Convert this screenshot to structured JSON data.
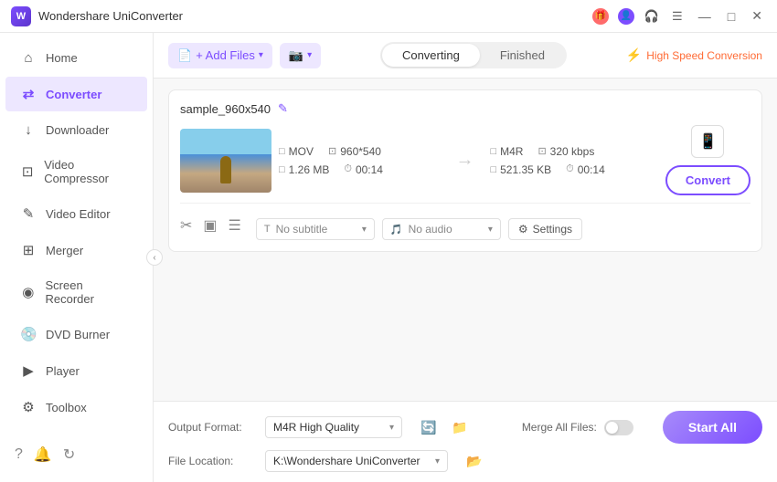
{
  "app": {
    "title": "Wondershare UniConverter",
    "logo_text": "W"
  },
  "titlebar": {
    "title": "Wondershare UniConverter",
    "icons": {
      "gift": "🎁",
      "user": "👤",
      "headset": "🎧",
      "menu": "☰",
      "minimize": "—",
      "maximize": "□",
      "close": "✕"
    }
  },
  "sidebar": {
    "items": [
      {
        "id": "home",
        "label": "Home",
        "icon": "⌂"
      },
      {
        "id": "converter",
        "label": "Converter",
        "icon": "⇄",
        "active": true
      },
      {
        "id": "downloader",
        "label": "Downloader",
        "icon": "↓"
      },
      {
        "id": "video-compressor",
        "label": "Video Compressor",
        "icon": "⊡"
      },
      {
        "id": "video-editor",
        "label": "Video Editor",
        "icon": "✎"
      },
      {
        "id": "merger",
        "label": "Merger",
        "icon": "⊞"
      },
      {
        "id": "screen-recorder",
        "label": "Screen Recorder",
        "icon": "◉"
      },
      {
        "id": "dvd-burner",
        "label": "DVD Burner",
        "icon": "💿"
      },
      {
        "id": "player",
        "label": "Player",
        "icon": "▶"
      },
      {
        "id": "toolbox",
        "label": "Toolbox",
        "icon": "⚙"
      }
    ],
    "bottom_icons": [
      "?",
      "🔔",
      "↻"
    ]
  },
  "toolbar": {
    "add_button": "+ Add Files",
    "snapshot_button": "📷",
    "tabs": {
      "converting": "Converting",
      "finished": "Finished"
    },
    "active_tab": "Converting",
    "high_speed": "High Speed Conversion",
    "bolt": "⚡"
  },
  "file": {
    "name": "sample_960x540",
    "edit_icon": "✎",
    "input": {
      "format": "MOV",
      "resolution": "960*540",
      "size": "1.26 MB",
      "duration": "00:14"
    },
    "arrow": "→",
    "output": {
      "format": "M4R",
      "bitrate": "320 kbps",
      "size": "521.35 KB",
      "duration": "00:14"
    },
    "device_icon": "📱",
    "convert_button": "Convert",
    "action_icons": {
      "cut": "✂",
      "crop": "▣",
      "effects": "☰"
    },
    "subtitle_dropdown": "No subtitle",
    "subtitle_icon": "T",
    "audio_dropdown": "No audio",
    "audio_icon": "🎵",
    "settings_button": "⚙ Settings"
  },
  "bottom": {
    "output_format_label": "Output Format:",
    "format_value": "M4R High Quality",
    "format_icons": [
      "🔄",
      "📁"
    ],
    "merge_label": "Merge All Files:",
    "file_location_label": "File Location:",
    "file_location_value": "K:\\Wondershare UniConverter",
    "start_all": "Start All"
  }
}
